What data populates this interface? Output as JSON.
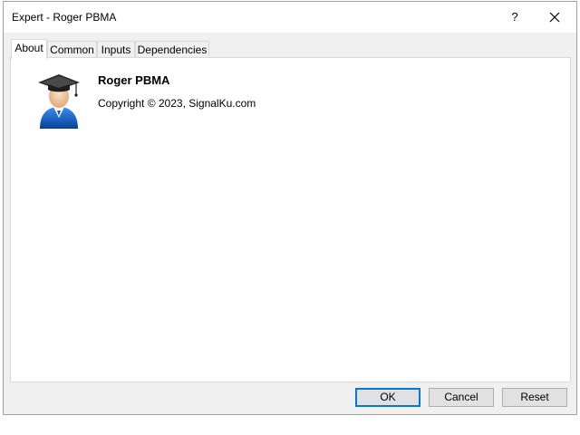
{
  "window": {
    "title": "Expert - Roger PBMA",
    "help_label": "?"
  },
  "tabs": [
    {
      "label": "About",
      "active": true
    },
    {
      "label": "Common",
      "active": false
    },
    {
      "label": "Inputs",
      "active": false
    },
    {
      "label": "Dependencies",
      "active": false
    }
  ],
  "about": {
    "name": "Roger PBMA",
    "copyright": "Copyright © 2023, SignalKu.com",
    "icon": "graduate-avatar-icon"
  },
  "buttons": {
    "ok": "OK",
    "cancel": "Cancel",
    "reset": "Reset"
  },
  "colors": {
    "accent": "#0078d7",
    "window_bg": "#f0f0f0",
    "panel_bg": "#ffffff"
  }
}
